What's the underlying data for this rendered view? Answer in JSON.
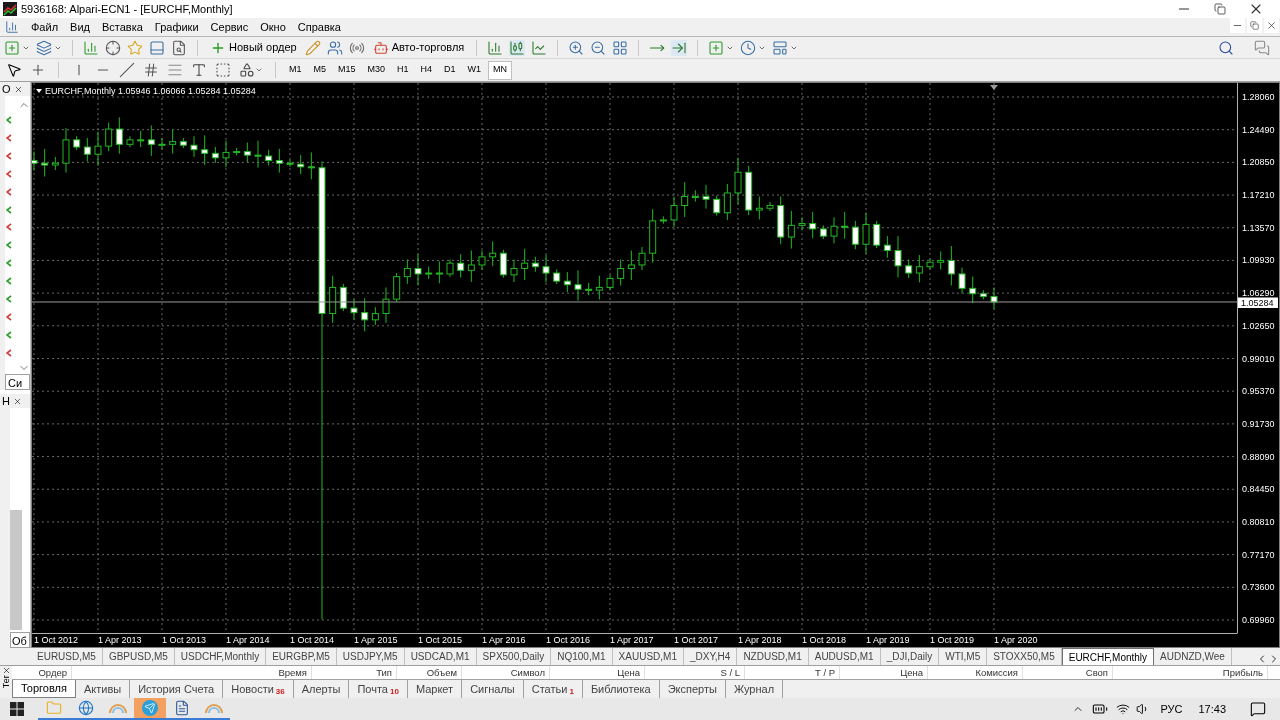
{
  "window": {
    "title": "5936168: Alpari-ECN1 - [EURCHF,Monthly]"
  },
  "menu": [
    "Файл",
    "Вид",
    "Вставка",
    "Графики",
    "Сервис",
    "Окно",
    "Справка"
  ],
  "toolbar": {
    "new_order": "Новый ордер",
    "auto_trading": "Авто-торговля"
  },
  "timeframes": [
    {
      "label": "M1",
      "selected": false
    },
    {
      "label": "M5",
      "selected": false
    },
    {
      "label": "M15",
      "selected": false
    },
    {
      "label": "M30",
      "selected": false
    },
    {
      "label": "H1",
      "selected": false
    },
    {
      "label": "H4",
      "selected": false
    },
    {
      "label": "D1",
      "selected": false
    },
    {
      "label": "W1",
      "selected": false
    },
    {
      "label": "MN",
      "selected": true
    }
  ],
  "market_watch": {
    "title": "О",
    "tab": "Си",
    "rows": [
      {
        "color": "#2e9e2e"
      },
      {
        "color": "#d04040"
      },
      {
        "color": "#d04040"
      },
      {
        "color": "#d04040"
      },
      {
        "color": "#d04040"
      },
      {
        "color": "#2e9e2e"
      },
      {
        "color": "#d04040"
      },
      {
        "color": "#2e9e2e"
      },
      {
        "color": "#2e9e2e"
      },
      {
        "color": "#2e9e2e"
      },
      {
        "color": "#2e9e2e"
      },
      {
        "color": "#d04040"
      },
      {
        "color": "#2e9e2e"
      },
      {
        "color": "#d04040"
      }
    ]
  },
  "navigator": {
    "title": "Н",
    "tab": "Об"
  },
  "chart": {
    "header": "EURCHF,Monthly  1.05946 1.06066 1.05284 1.05284",
    "current_price": "1.05284",
    "price_labels": [
      "1.28060",
      "1.24490",
      "1.20850",
      "1.17210",
      "1.13570",
      "1.09930",
      "1.06290",
      "1.02650",
      "0.99010",
      "0.95370",
      "0.91730",
      "0.88090",
      "0.84450",
      "0.80810",
      "0.77170",
      "0.73600",
      "0.69960"
    ],
    "time_labels": [
      "1 Oct 2012",
      "1 Apr 2013",
      "1 Oct 2013",
      "1 Apr 2014",
      "1 Oct 2014",
      "1 Apr 2015",
      "1 Oct 2015",
      "1 Apr 2016",
      "1 Oct 2016",
      "1 Apr 2017",
      "1 Oct 2017",
      "1 Apr 2018",
      "1 Oct 2018",
      "1 Apr 2019",
      "1 Oct 2019",
      "1 Apr 2020"
    ]
  },
  "chart_tabs": [
    {
      "label": "EURUSD,M5",
      "selected": false
    },
    {
      "label": "GBPUSD,M5",
      "selected": false
    },
    {
      "label": "USDCHF,Monthly",
      "selected": false
    },
    {
      "label": "EURGBP,M5",
      "selected": false
    },
    {
      "label": "USDJPY,M5",
      "selected": false
    },
    {
      "label": "USDCAD,M1",
      "selected": false
    },
    {
      "label": "SPX500,Daily",
      "selected": false
    },
    {
      "label": "NQ100,M1",
      "selected": false
    },
    {
      "label": "XAUUSD,M1",
      "selected": false
    },
    {
      "label": "_DXY,H4",
      "selected": false
    },
    {
      "label": "NZDUSD,M1",
      "selected": false
    },
    {
      "label": "AUDUSD,M1",
      "selected": false
    },
    {
      "label": "_DJI,Daily",
      "selected": false
    },
    {
      "label": "WTI,M5",
      "selected": false
    },
    {
      "label": "STOXX50,M5",
      "selected": false
    },
    {
      "label": "EURCHF,Monthly",
      "selected": true
    },
    {
      "label": "AUDNZD,Wee",
      "selected": false
    }
  ],
  "terminal": {
    "side_label": "Тег",
    "columns": [
      "Ордер",
      "Время",
      "Тип",
      "Объем",
      "Символ",
      "Цена",
      "S / L",
      "T / P",
      "Цена",
      "Комиссия",
      "Своп",
      "Прибыль"
    ],
    "tabs": [
      {
        "label": "Торговля",
        "selected": true
      },
      {
        "label": "Активы",
        "selected": false
      },
      {
        "label": "История Счета",
        "selected": false
      },
      {
        "label": "Новости",
        "badge": "36",
        "selected": false
      },
      {
        "label": "Алерты",
        "selected": false
      },
      {
        "label": "Почта",
        "badge": "10",
        "selected": false
      },
      {
        "label": "Маркет",
        "selected": false
      },
      {
        "label": "Сигналы",
        "selected": false
      },
      {
        "label": "Статьи",
        "badge": "1",
        "selected": false
      },
      {
        "label": "Библиотека",
        "selected": false
      },
      {
        "label": "Эксперты",
        "selected": false
      },
      {
        "label": "Журнал",
        "selected": false
      }
    ]
  },
  "taskbar": {
    "apps": [
      {
        "kind": "folder",
        "selected": false
      },
      {
        "kind": "browser",
        "selected": false
      },
      {
        "kind": "alpari",
        "selected": false
      },
      {
        "kind": "telegram",
        "selected": true
      },
      {
        "kind": "word",
        "selected": false
      },
      {
        "kind": "alpari",
        "selected": false
      }
    ],
    "language": "РУС",
    "time": "17:43"
  }
}
